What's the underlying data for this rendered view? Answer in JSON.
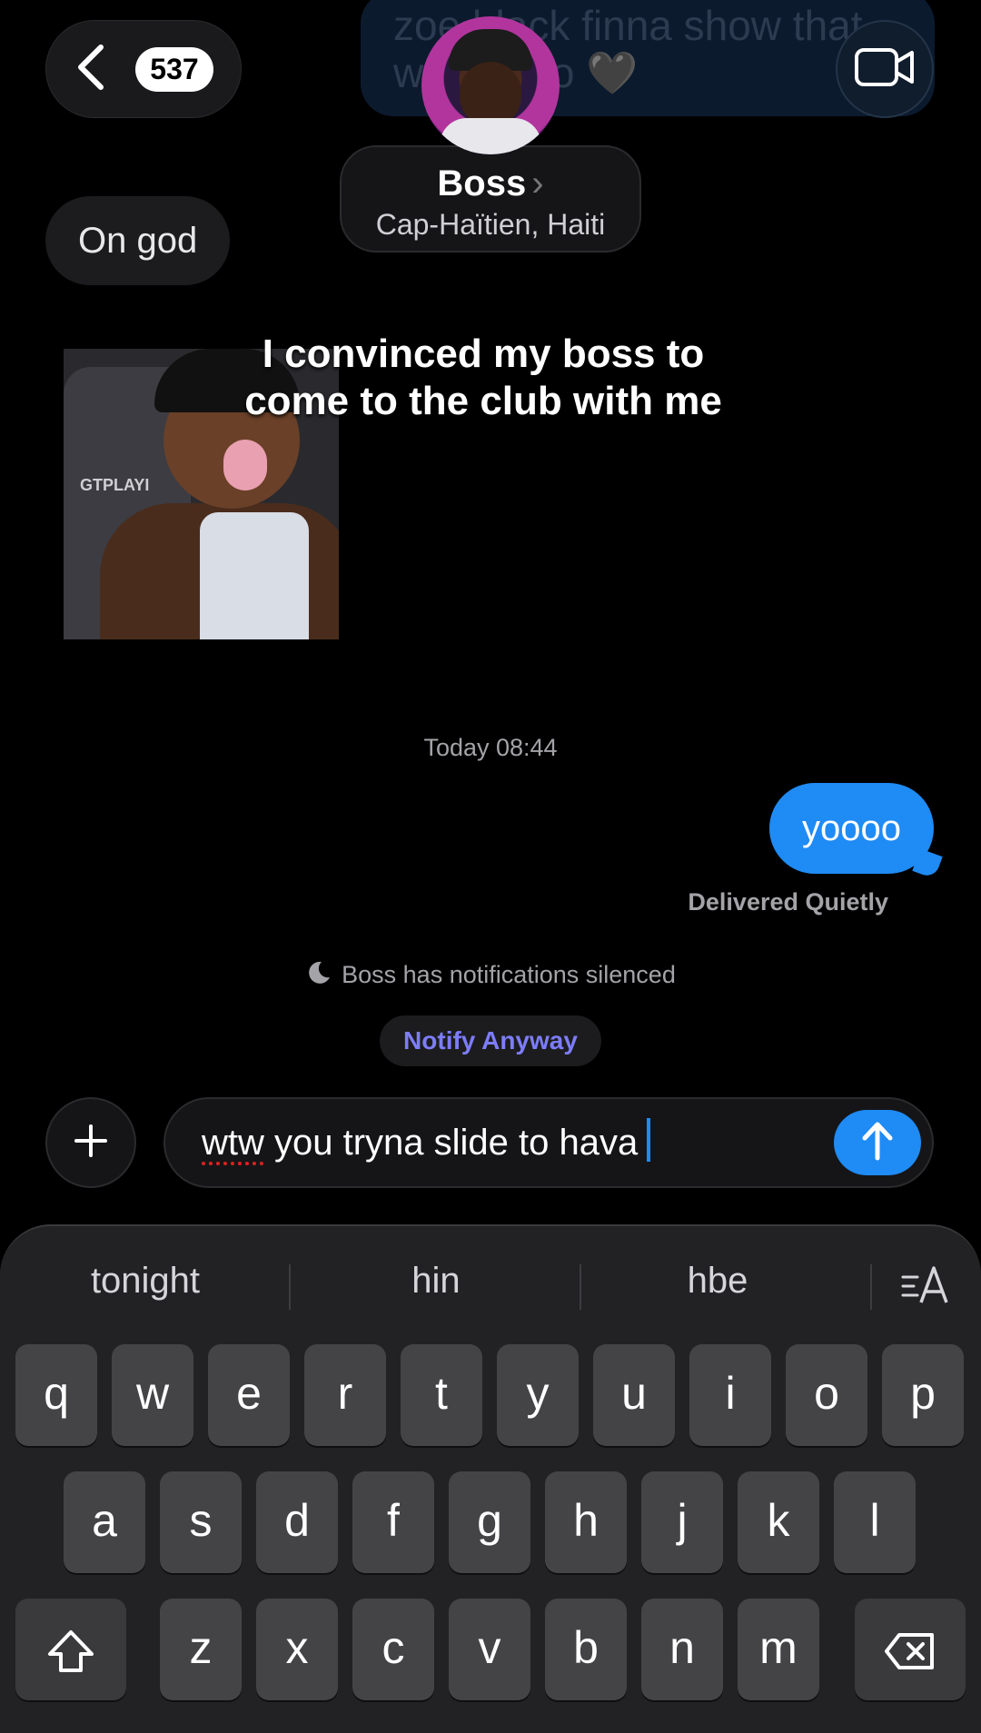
{
  "header": {
    "back_count": "537",
    "contact_name": "Boss",
    "contact_chevron": "›",
    "contact_location": "Cap-Haïtien, Haiti",
    "faded_text": "zoe black finna show that w pr... tho 🖤"
  },
  "messages": {
    "incoming_text": "On god",
    "meme_caption": "I convinced my boss to come to the club with me",
    "meme_watermark": "GTPLAYI",
    "timestamp": "Today 08:44",
    "outgoing_text": "yoooo",
    "delivered_status": "Delivered Quietly",
    "silenced_notice": "Boss has notifications silenced",
    "notify_anyway": "Notify Anyway"
  },
  "compose": {
    "misspelled_word": "wtw",
    "text_rest": " you tryna slide to hava"
  },
  "keyboard": {
    "suggestions": [
      "tonight",
      "hin",
      "hbe"
    ],
    "row1": [
      "q",
      "w",
      "e",
      "r",
      "t",
      "y",
      "u",
      "i",
      "o",
      "p"
    ],
    "row2": [
      "a",
      "s",
      "d",
      "f",
      "g",
      "h",
      "j",
      "k",
      "l"
    ],
    "row3": [
      "z",
      "x",
      "c",
      "v",
      "b",
      "n",
      "m"
    ]
  },
  "colors": {
    "accent_blue": "#1f8bf5",
    "notify_purple": "#7d7dfb",
    "background": "#000000"
  },
  "icons": {
    "back": "chevron-left-icon",
    "video": "video-camera-icon",
    "plus": "plus-icon",
    "send": "arrow-up-icon",
    "moon": "moon-icon",
    "shift": "shift-icon",
    "delete": "delete-icon",
    "text_format": "text-format-icon"
  }
}
